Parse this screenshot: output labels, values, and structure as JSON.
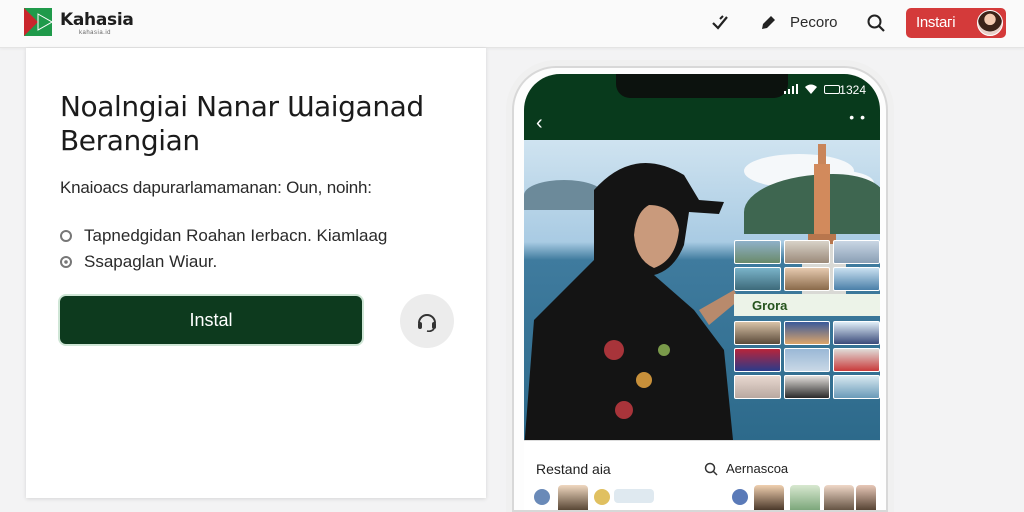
{
  "header": {
    "brand": "Kahasia",
    "brand_sub": "kahasia.id",
    "nav_label": "Pecoro",
    "install_label": "Instaгі"
  },
  "card": {
    "headline_line1": "Noalngiai Nanar Ɯaiganad",
    "headline_line2": "Berangian",
    "subline": "Knaioacs dapurarlamamanan: Oun, noinh:",
    "features": [
      "Tapnedgidan Roahan Ierbacn. Kiamlaag",
      "Ssapaglan Wiaur."
    ],
    "install_button": "Instal"
  },
  "phone": {
    "status_time": "1324",
    "collage_label": "Grora",
    "sheet_left": "Restand aia",
    "sheet_right": "Aernascoa"
  },
  "colors": {
    "brand_green": "#083a1c",
    "install_red": "#d43a3a",
    "button_green": "#0d3a1e"
  },
  "icons": [
    "check-icon",
    "pen-icon",
    "search-icon",
    "headset-icon",
    "back-icon",
    "more-icon"
  ]
}
